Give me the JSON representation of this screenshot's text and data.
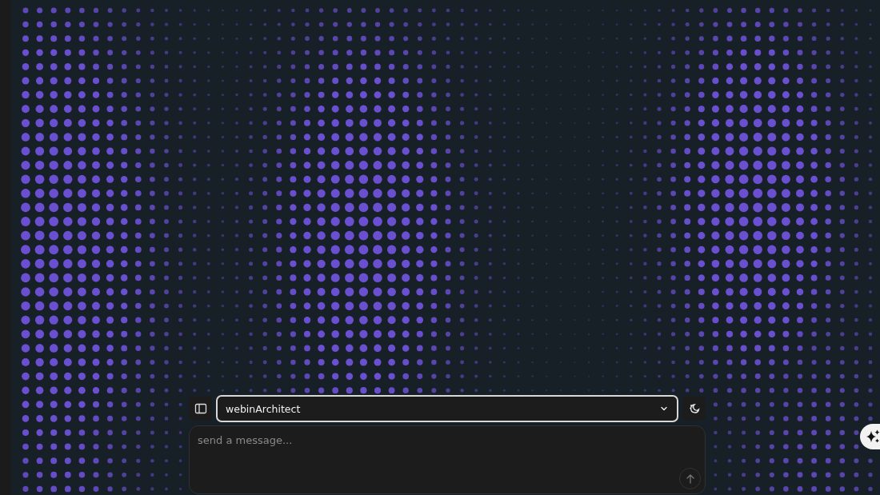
{
  "model_select": {
    "value": "webinArchitect"
  },
  "message_input": {
    "placeholder": "send a message..."
  }
}
